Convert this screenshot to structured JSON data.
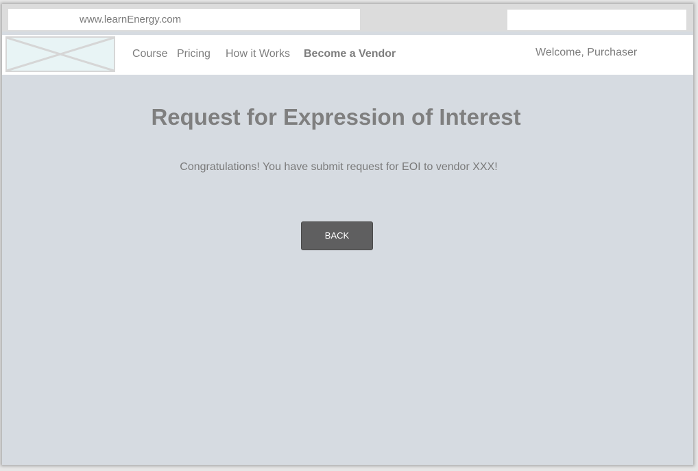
{
  "browser": {
    "url": "www.learnEnergy.com",
    "search_value": ""
  },
  "nav": {
    "items": [
      {
        "label": "Course"
      },
      {
        "label": "Pricing"
      },
      {
        "label": "How it Works"
      },
      {
        "label": "Become a Vendor"
      }
    ],
    "welcome": "Welcome, Purchaser"
  },
  "main": {
    "title": "Request for Expression of Interest",
    "message": "Congratulations! You have submit request for EOI to vendor XXX!",
    "back_label": "BACK"
  },
  "icons": {
    "logo": "image-placeholder-icon"
  },
  "colors": {
    "page_background": "#d6dbe1",
    "button_background": "#5f5f60",
    "text_gray": "#7d7d7d"
  }
}
